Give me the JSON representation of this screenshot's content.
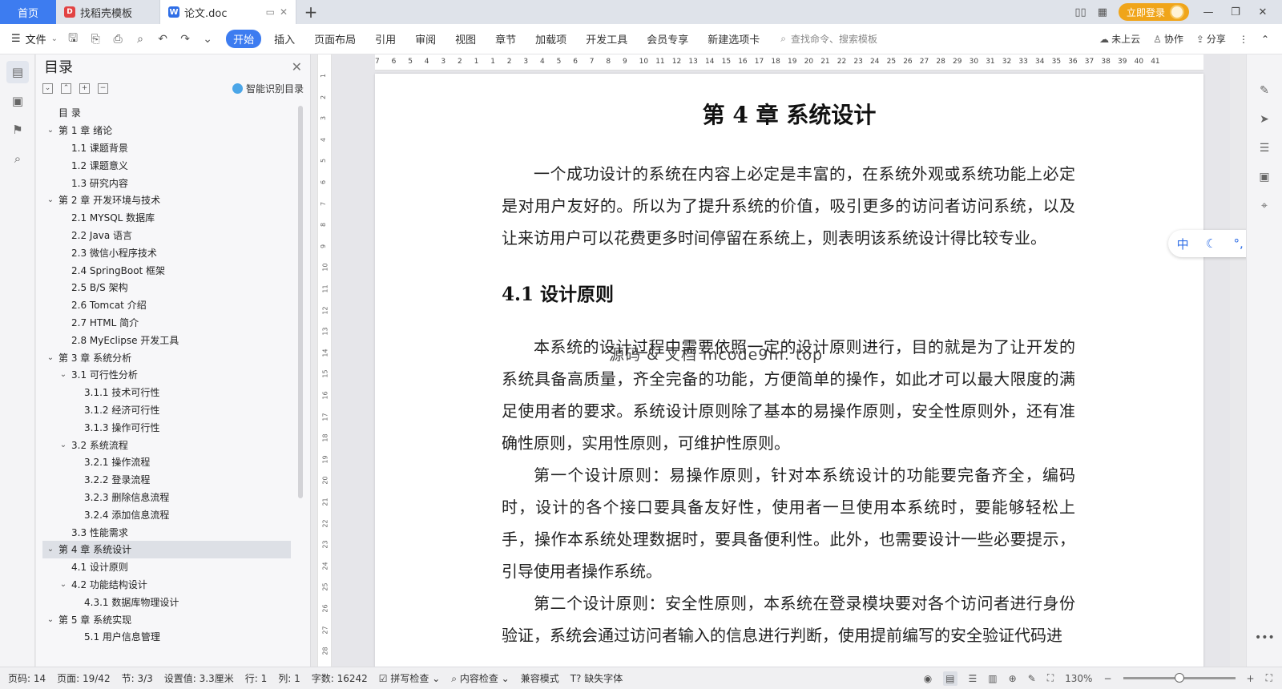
{
  "tabs": {
    "home": "首页",
    "template_tab": "找稻壳模板",
    "doc_tab": "论文.doc"
  },
  "titlebar": {
    "login": "立即登录"
  },
  "menu": {
    "file": "文件",
    "items": [
      "开始",
      "插入",
      "页面布局",
      "引用",
      "审阅",
      "视图",
      "章节",
      "加载项",
      "开发工具",
      "会员专享",
      "新建选项卡"
    ],
    "search_placeholder": "查找命令、搜索模板",
    "cloud": "未上云",
    "collab": "协作",
    "share": "分享"
  },
  "toc": {
    "title": "目录",
    "smart": "智能识别目录",
    "items": [
      {
        "label": "目  录",
        "level": 0,
        "chevron": ""
      },
      {
        "label": "第 1 章  绪论",
        "level": 0,
        "chevron": "v"
      },
      {
        "label": "1.1  课题背景",
        "level": 1,
        "chevron": ""
      },
      {
        "label": "1.2  课题意义",
        "level": 1,
        "chevron": ""
      },
      {
        "label": "1.3  研究内容",
        "level": 1,
        "chevron": ""
      },
      {
        "label": "第 2 章  开发环境与技术",
        "level": 0,
        "chevron": "v"
      },
      {
        "label": "2.1 MYSQL 数据库",
        "level": 1,
        "chevron": ""
      },
      {
        "label": "2.2 Java 语言",
        "level": 1,
        "chevron": ""
      },
      {
        "label": "2.3  微信小程序技术",
        "level": 1,
        "chevron": ""
      },
      {
        "label": "2.4 SpringBoot 框架",
        "level": 1,
        "chevron": ""
      },
      {
        "label": "2.5 B/S 架构",
        "level": 1,
        "chevron": ""
      },
      {
        "label": "2.6 Tomcat  介绍",
        "level": 1,
        "chevron": ""
      },
      {
        "label": "2.7 HTML 简介",
        "level": 1,
        "chevron": ""
      },
      {
        "label": "2.8 MyEclipse 开发工具",
        "level": 1,
        "chevron": ""
      },
      {
        "label": "第 3 章  系统分析",
        "level": 0,
        "chevron": "v"
      },
      {
        "label": "3.1  可行性分析",
        "level": 1,
        "chevron": "v"
      },
      {
        "label": "3.1.1  技术可行性",
        "level": 2,
        "chevron": ""
      },
      {
        "label": "3.1.2  经济可行性",
        "level": 2,
        "chevron": ""
      },
      {
        "label": "3.1.3  操作可行性",
        "level": 2,
        "chevron": ""
      },
      {
        "label": "3.2  系统流程",
        "level": 1,
        "chevron": "v"
      },
      {
        "label": "3.2.1  操作流程",
        "level": 2,
        "chevron": ""
      },
      {
        "label": "3.2.2  登录流程",
        "level": 2,
        "chevron": ""
      },
      {
        "label": "3.2.3  删除信息流程",
        "level": 2,
        "chevron": ""
      },
      {
        "label": "3.2.4  添加信息流程",
        "level": 2,
        "chevron": ""
      },
      {
        "label": "3.3  性能需求",
        "level": 1,
        "chevron": ""
      },
      {
        "label": "第 4 章  系统设计",
        "level": 0,
        "chevron": "v",
        "selected": true
      },
      {
        "label": "4.1  设计原则",
        "level": 1,
        "chevron": ""
      },
      {
        "label": "4.2  功能结构设计",
        "level": 1,
        "chevron": "v"
      },
      {
        "label": "4.3.1  数据库物理设计",
        "level": 2,
        "chevron": ""
      },
      {
        "label": "第 5 章  系统实现",
        "level": 0,
        "chevron": "v"
      },
      {
        "label": "5.1 用户信息管理",
        "level": 2,
        "chevron": ""
      }
    ]
  },
  "ruler": {
    "h_ticks": [
      "7",
      "6",
      "5",
      "4",
      "3",
      "2",
      "1",
      "1",
      "2",
      "3",
      "4",
      "5",
      "6",
      "7",
      "8",
      "9",
      "10",
      "11",
      "12",
      "13",
      "14",
      "15",
      "16",
      "17",
      "18",
      "19",
      "20",
      "21",
      "22",
      "23",
      "24",
      "25",
      "26",
      "27",
      "28",
      "29",
      "30",
      "31",
      "32",
      "33",
      "34",
      "35",
      "36",
      "37",
      "38",
      "39",
      "40",
      "41"
    ],
    "v_ticks": [
      "1",
      "2",
      "3",
      "4",
      "5",
      "6",
      "7",
      "8",
      "9",
      "10",
      "11",
      "12",
      "13",
      "14",
      "15",
      "16",
      "17",
      "18",
      "19",
      "20",
      "21",
      "22",
      "23",
      "24",
      "25",
      "26",
      "27",
      "28"
    ]
  },
  "document": {
    "chapter_title": "第 4 章  系统设计",
    "intro": "一个成功设计的系统在内容上必定是丰富的，在系统外观或系统功能上必定是对用户友好的。所以为了提升系统的价值，吸引更多的访问者访问系统，以及让来访用户可以花费更多时间停留在系统上，则表明该系统设计得比较专业。",
    "section_title": "4.1  设计原则",
    "para1": "本系统的设计过程中需要依照一定的设计原则进行，目的就是为了让开发的系统具备高质量，齐全完备的功能，方便简单的操作，如此才可以最大限度的满足使用者的要求。系统设计原则除了基本的易操作原则，安全性原则外，还有准确性原则，实用性原则，可维护性原则。",
    "para2": "第一个设计原则：易操作原则，针对本系统设计的功能要完备齐全，编码时，设计的各个接口要具备友好性，使用者一旦使用本系统时，要能够轻松上手，操作本系统处理数据时，要具备便利性。此外，也需要设计一些必要提示，引导使用者操作系统。",
    "para3": "第二个设计原则：安全性原则，本系统在登录模块要对各个访问者进行身份验证，系统会通过访问者输入的信息进行判断，使用提前编写的安全验证代码进",
    "watermark": "源码 & 文档 mcode9m. top"
  },
  "ime": {
    "lang": "中"
  },
  "status": {
    "page_num": "页码: 14",
    "pages": "页面: 19/42",
    "section": "节: 3/3",
    "setting": "设置值: 3.3厘米",
    "row": "行: 1",
    "col": "列: 1",
    "word_count": "字数: 16242",
    "spell": "拼写检查",
    "content_check": "内容检查",
    "compat": "兼容模式",
    "missing_font": "缺失字体",
    "zoom": "130%"
  }
}
